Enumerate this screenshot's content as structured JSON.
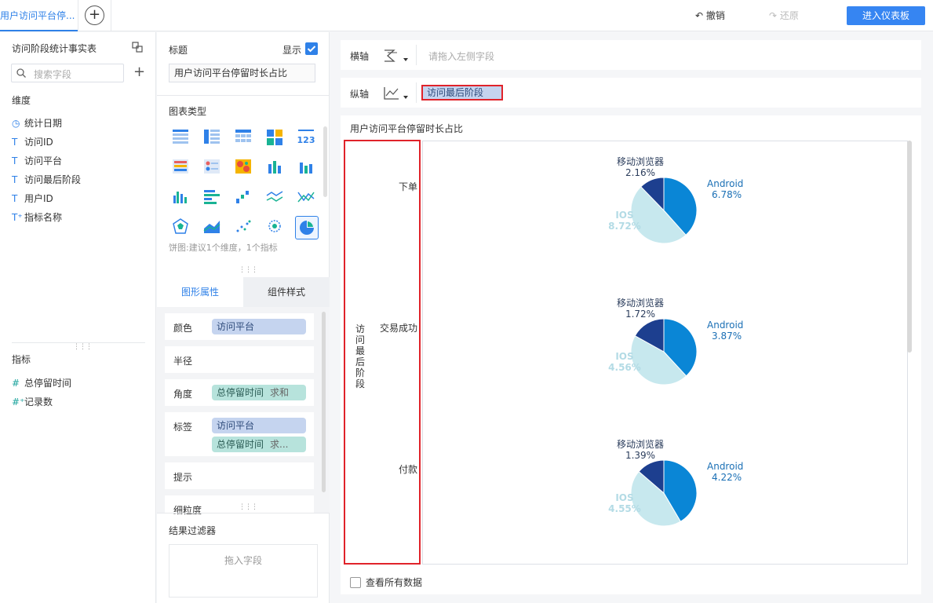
{
  "topbar": {
    "tab_label": "用户访问平台停...",
    "undo_label": "撤销",
    "redo_label": "还原",
    "dashboard_button": "进入仪表板"
  },
  "fields_panel": {
    "title": "访问阶段统计事实表",
    "search_placeholder": "搜索字段",
    "dimension_label": "维度",
    "dimensions": [
      {
        "icon": "clock-icon",
        "name": "统计日期"
      },
      {
        "icon": "text-icon",
        "name": "访问ID"
      },
      {
        "icon": "text-icon",
        "name": "访问平台"
      },
      {
        "icon": "text-icon",
        "name": "访问最后阶段"
      },
      {
        "icon": "text-icon",
        "name": "用户ID"
      },
      {
        "icon": "text-plus-icon",
        "name": "指标名称"
      }
    ],
    "measure_label": "指标",
    "measures": [
      {
        "icon": "hash-icon",
        "name": "总停留时间"
      },
      {
        "icon": "hash-plus-icon",
        "name": "记录数"
      }
    ]
  },
  "config_panel": {
    "title_label": "标题",
    "show_label": "显示",
    "title_value": "用户访问平台停留时长占比",
    "chart_type_label": "图表类型",
    "chart_type_hint": "饼图:建议1个维度，1个指标",
    "tabs": [
      "图形属性",
      "组件样式"
    ],
    "properties": [
      {
        "name": "颜色",
        "pills": [
          {
            "text": "访问平台",
            "color": "blue"
          }
        ]
      },
      {
        "name": "半径",
        "pills": []
      },
      {
        "name": "角度",
        "pills": [
          {
            "text": "总停留时间",
            "agg": "求和",
            "color": "teal"
          }
        ]
      },
      {
        "name": "标签",
        "pills": [
          {
            "text": "访问平台",
            "color": "blue"
          },
          {
            "text": "总停留时间",
            "agg": "求...",
            "color": "teal"
          }
        ]
      },
      {
        "name": "提示",
        "pills": []
      },
      {
        "name": "细粒度",
        "pills": []
      }
    ],
    "filter_label": "结果过滤器",
    "filter_placeholder": "拖入字段"
  },
  "axes": {
    "x_label": "横轴",
    "x_placeholder": "请拖入左侧字段",
    "y_label": "纵轴",
    "y_field": "访问最后阶段"
  },
  "chart_area": {
    "view_all_label": "查看所有数据"
  },
  "chart_data": {
    "type": "pie",
    "title": "用户访问平台停留时长占比",
    "row_dimension": "访问最后阶段",
    "colors": {
      "Android": "#0a86d6",
      "IOS": "#c7e8ee",
      "移动浏览器": "#1d3f8f"
    },
    "label_colors": {
      "Android": "#1a6fb5",
      "IOS": "#b3dbe5",
      "移动浏览器": "#2b3d5c"
    },
    "pies": [
      {
        "category": "下单",
        "slices": [
          {
            "name": "Android",
            "value": 6.78,
            "label": "6.78%"
          },
          {
            "name": "IOS",
            "value": 8.72,
            "label": "8.72%"
          },
          {
            "name": "移动浏览器",
            "value": 2.16,
            "label": "2.16%"
          }
        ]
      },
      {
        "category": "交易成功",
        "slices": [
          {
            "name": "Android",
            "value": 3.87,
            "label": "3.87%"
          },
          {
            "name": "IOS",
            "value": 4.56,
            "label": "4.56%"
          },
          {
            "name": "移动浏览器",
            "value": 1.72,
            "label": "1.72%"
          }
        ]
      },
      {
        "category": "付款",
        "slices": [
          {
            "name": "Android",
            "value": 4.22,
            "label": "4.22%"
          },
          {
            "name": "IOS",
            "value": 4.55,
            "label": "4.55%"
          },
          {
            "name": "移动浏览器",
            "value": 1.39,
            "label": "1.39%"
          }
        ]
      }
    ]
  }
}
